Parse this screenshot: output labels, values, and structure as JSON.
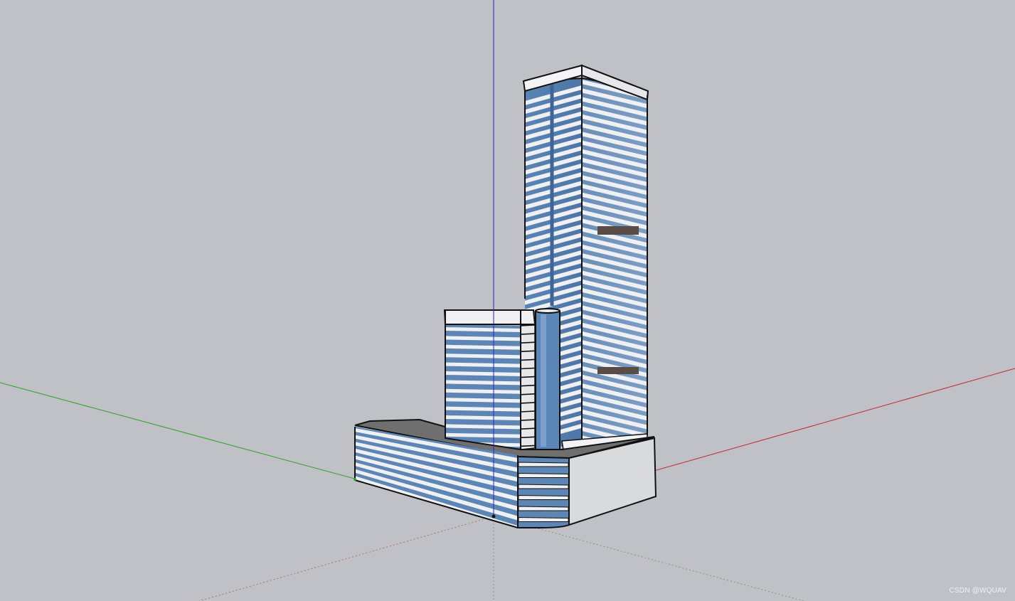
{
  "viewport": {
    "background_color": "#bfc1c6",
    "axis_colors": {
      "red_axis": "#c0282d",
      "green_axis": "#2fa12c",
      "blue_axis": "#2424c8"
    },
    "model_colors": {
      "glass_blue": "#5d86b4",
      "band_white": "#eef0f3",
      "edge_black": "#111111",
      "roof_gray": "#6f6f70",
      "wall_light": "#d9dadc"
    }
  },
  "watermark": {
    "text": "CSDN @WQUAV"
  }
}
